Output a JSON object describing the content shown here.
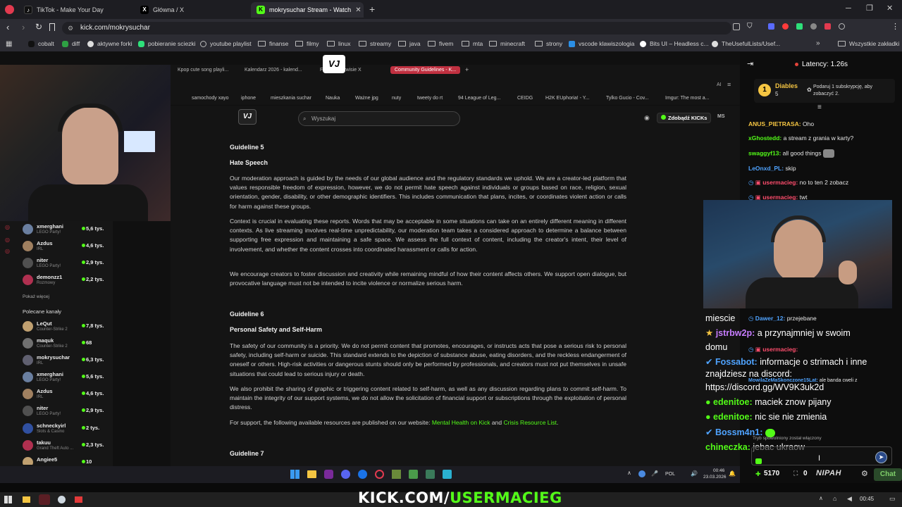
{
  "browser": {
    "tabs": [
      {
        "title": "TikTok - Make Your Day"
      },
      {
        "title": "Główna / X"
      },
      {
        "title": "mokrysuchar Stream - Watch"
      }
    ],
    "url": "kick.com/mokrysuchar",
    "bookmarks": [
      "cobalt",
      "diff",
      "aktywne forki",
      "pobieranie sciezki",
      "youtube playlist",
      "finanse",
      "filmy",
      "linux",
      "streamy",
      "java",
      "fivem",
      "mta",
      "minecraft",
      "strony",
      "vscode klawiszologia",
      "Bits UI – Headless c...",
      "TheUsefulLists/Usef..."
    ],
    "bookmarks_other": "Wszystkie zakładki"
  },
  "inner_browser": {
    "tabs": [
      "Kpop cute song playli...",
      "Kalendarz 2026 - kalend...",
      "Firma w serwisie X",
      "Community Guidelines - K..."
    ],
    "bookmarks": [
      "samochody xayo",
      "iphone",
      "mieszkania suchar",
      "Nauka",
      "Ważne jpg",
      "nuty",
      "tweety do rt",
      "94 League of Leg...",
      "CEIDG",
      "H2K EUphoria! - Y...",
      "Tylko Gucio - Cov...",
      "Imgur: The most a..."
    ],
    "search_placeholder": "Wyszukaj",
    "kicks_button": "Zdobądź KICKs",
    "avatar_initials": "MS"
  },
  "document": {
    "g5_title": "Guideline 5",
    "g5_heading": "Hate Speech",
    "g5_p1": "Our moderation approach is guided by the needs of our global audience and the regulatory standards we uphold. We are a creator-led platform that values responsible freedom of expression, however, we do not permit hate speech against individuals or groups based on race, religion, sexual orientation, gender, disability, or other demographic identifiers. This includes communication that plans, incites, or coordinates violent action or calls for harm against these groups.",
    "g5_p2": "Context is crucial in evaluating these reports. Words that may be acceptable in some situations can take on an entirely different meaning in different contexts. As live streaming involves real-time unpredictability, our moderation team takes a considered approach to determine a balance between supporting free expression and maintaining a safe space. We assess the full context of content, including the creator's intent, their level of involvement, and whether the content crosses into coordinated harassment or calls for action.",
    "g5_p3": "We encourage creators to foster discussion and creativity while remaining mindful of how their content affects others. We support open dialogue, but provocative language must not be intended to incite violence or normalize serious harm.",
    "g6_title": "Guideline 6",
    "g6_heading": "Personal Safety and Self-Harm",
    "g6_p1": "The safety of our community is a priority. We do not permit content that promotes, encourages, or instructs acts that pose a serious risk to personal safety, including self-harm or suicide. This standard extends to the depiction of substance abuse, eating disorders, and the reckless endangerment of oneself or others. High-risk activities or dangerous stunts should only be performed by professionals, and creators must not put themselves in unsafe situations that could lead to serious injury or death.",
    "g6_p2": "We also prohibit the sharing of graphic or triggering content related to self-harm, as well as any discussion regarding plans to commit self-harm. To maintain the integrity of our support systems, we do not allow the solicitation of financial support or subscriptions through the exploitation of personal distress.",
    "g6_p3_prefix": "For support, the following available resources are published on our website:",
    "g6_link1": "Mental Health on Kick",
    "g6_and": "and",
    "g6_link2": "Crisis Resource List",
    "g6_p3_suffix": ".",
    "g7_title": "Guideline 7"
  },
  "kick_sidebar": {
    "channels": [
      {
        "name": "xmerghani",
        "game": "LEGO Party!",
        "viewers": "5,6 tys."
      },
      {
        "name": "Azdus",
        "game": "IRL",
        "viewers": "4,6 tys."
      },
      {
        "name": "niter",
        "game": "LEGO Party!",
        "viewers": "2,9 tys."
      },
      {
        "name": "demonzz1",
        "game": "Rozmowy",
        "viewers": "2,2 tys."
      }
    ],
    "show_more": "Pokaż więcej",
    "recommended_title": "Polecane kanały",
    "recommended": [
      {
        "name": "LeQut",
        "game": "Counter-Strike 2",
        "viewers": "7,8 tys."
      },
      {
        "name": "maquk",
        "game": "Counter-Strike 2",
        "viewers": "68"
      },
      {
        "name": "mokrysuchar",
        "game": "IRL",
        "viewers": "6,3 tys."
      },
      {
        "name": "xmerghani",
        "game": "LEGO Party!",
        "viewers": "5,6 tys."
      },
      {
        "name": "Azdus",
        "game": "IRL",
        "viewers": "4,6 tys."
      },
      {
        "name": "niter",
        "game": "LEGO Party!",
        "viewers": "2,9 tys."
      },
      {
        "name": "schneckyirl",
        "game": "Slots & Casino",
        "viewers": "2 tys."
      },
      {
        "name": "takuu",
        "game": "Grand Theft Auto ...",
        "viewers": "2,3 tys."
      },
      {
        "name": "Angiee5",
        "game": "",
        "viewers": "10"
      }
    ]
  },
  "chat": {
    "latency": "Latency: 1.26s",
    "gifter_name": "Diables",
    "gifter_count": "5",
    "gifter_text": "Podaruj 1 subskrypcję, aby zobaczyć 2.",
    "small_messages": [
      {
        "user": "ANUS_PIETRASA:",
        "text": "Oho",
        "color": "#f5c542"
      },
      {
        "user": "xGhostedd:",
        "text": "a stream z grania w karty?",
        "color": "#53fc18"
      },
      {
        "user": "swaggyf13:",
        "text": "all good things",
        "color": "#53fc18"
      },
      {
        "user": "LeOnxd_PL:",
        "text": "skip",
        "color": "#4fa3ff"
      },
      {
        "user": "usermacieg:",
        "text": "no to ten 2 zobacz",
        "color": "#ff4d6d"
      },
      {
        "user": "usermacieg:",
        "text": "twt",
        "color": "#ff4d6d"
      }
    ],
    "overlay_messages": [
      {
        "user": "",
        "text": "miescie",
        "color": "#fff"
      },
      {
        "user": "Dawer_12:",
        "text": "przejebane",
        "color": "#4fa3ff",
        "small": true
      },
      {
        "user": "jstrbw2p:",
        "text": "a przynajmniej w swoim",
        "color": "#c77dff"
      },
      {
        "user": "",
        "text": "domu",
        "color": "#fff"
      },
      {
        "user": "usermacieg:",
        "text": "",
        "color": "#ff4d6d",
        "small": true
      },
      {
        "user": "Fossabot:",
        "text": "informacje o strimach i inne",
        "color": "#4fa3ff"
      },
      {
        "user": "",
        "text": "znajdziesz na discord:",
        "color": "#fff"
      },
      {
        "user": "",
        "text": "https://discord.gg/WV9K3uk2d",
        "color": "#fff"
      },
      {
        "user": "MowilaZeMaSkonczone15Lat:",
        "text": "ale banda cweli z",
        "color": "#4fa3ff",
        "small": true
      },
      {
        "user": "edenitoe:",
        "text": "maciek znow pijany",
        "color": "#53fc18"
      },
      {
        "user": "edenitoe:",
        "text": "nic sie nie zmienia",
        "color": "#53fc18"
      },
      {
        "user": "Bossm4n1:",
        "text": "",
        "color": "#4fa3ff"
      },
      {
        "user": "",
        "text": "Tryb spowolniony został włączony",
        "color": "#aaa",
        "small": true
      },
      {
        "user": "chineczka:",
        "text": "jebac ukraow",
        "color": "#53fc18"
      }
    ],
    "kicks_count": "5170",
    "lock_count": "0",
    "brand": "NIPAH",
    "chat_button": "Chat"
  },
  "stream_taskbar": {
    "lang": "POL",
    "time": "00:46",
    "date": "23.03.2026"
  },
  "windows": {
    "time": "00:45"
  },
  "banner": {
    "prefix": "KICK.COM/",
    "suffix": "USERMACIEG"
  },
  "colors": {
    "kick_green": "#53fc18",
    "bg_dark": "#141414"
  }
}
